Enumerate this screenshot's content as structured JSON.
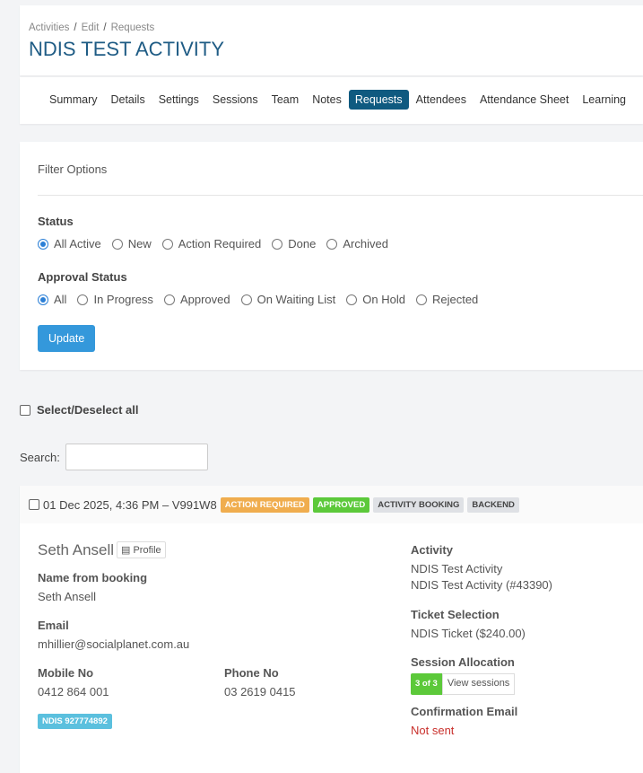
{
  "breadcrumb": [
    "Activities",
    "Edit",
    "Requests"
  ],
  "title": "NDIS TEST ACTIVITY",
  "tabs": [
    "Summary",
    "Details",
    "Settings",
    "Sessions",
    "Team",
    "Notes",
    "Requests",
    "Attendees",
    "Attendance Sheet",
    "Learning"
  ],
  "active_tab": "Requests",
  "filter": {
    "heading": "Filter Options",
    "status_label": "Status",
    "status_options": [
      "All Active",
      "New",
      "Action Required",
      "Done",
      "Archived"
    ],
    "status_selected": "All Active",
    "approval_label": "Approval Status",
    "approval_options": [
      "All",
      "In Progress",
      "Approved",
      "On Waiting List",
      "On Hold",
      "Rejected"
    ],
    "approval_selected": "All",
    "update": "Update"
  },
  "select_all": "Select/Deselect all",
  "search": {
    "label": "Search:",
    "value": ""
  },
  "request": {
    "header": "01 Dec 2025, 4:36 PM – V991W8",
    "badges": [
      "ACTION REQUIRED",
      "APPROVED",
      "ACTIVITY BOOKING",
      "BACKEND"
    ],
    "name": "Seth Ansell",
    "profile": "Profile",
    "name_from_booking_label": "Name from booking",
    "name_from_booking": "Seth Ansell",
    "email_label": "Email",
    "email": "mhillier@socialplanet.com.au",
    "mobile_label": "Mobile No",
    "mobile": "0412 864 001",
    "phone_label": "Phone No",
    "phone": "03 2619 0415",
    "ndis": "NDIS 927774892",
    "activity_label": "Activity",
    "activity_1": "NDIS Test Activity",
    "activity_2": "NDIS Test Activity (#43390)",
    "ticket_label": "Ticket Selection",
    "ticket": "NDIS Ticket ($240.00)",
    "session_label": "Session Allocation",
    "session_count": "3 of 3",
    "view_sessions": "View sessions",
    "confirm_label": "Confirmation Email",
    "confirm": "Not sent"
  },
  "colors": {
    "accent": "#0f5a80",
    "button": "#3498db",
    "orange": "#f0ad4e",
    "green": "#5cc93a",
    "info": "#5bc0de"
  }
}
